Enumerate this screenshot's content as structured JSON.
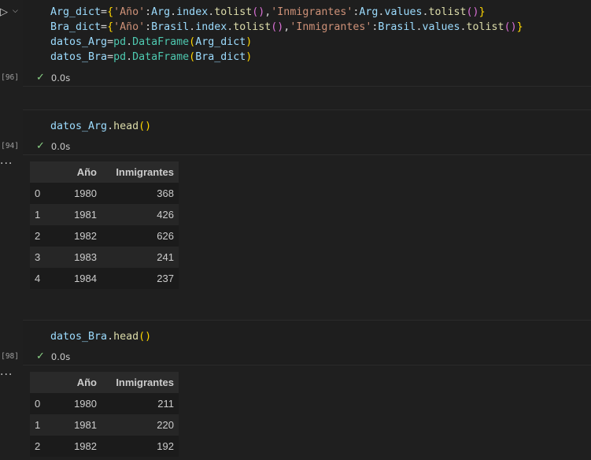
{
  "cell1": {
    "exec": "[96]",
    "status": "0.0s",
    "lines": [
      "Arg_dict={'Año':Arg.index.tolist(),'Inmigrantes':Arg.values.tolist()}",
      "Bra_dict={'Año':Brasil.index.tolist(),'Inmigrantes':Brasil.values.tolist()}",
      "datos_Arg=pd.DataFrame(Arg_dict)",
      "datos_Bra=pd.DataFrame(Bra_dict)"
    ]
  },
  "cell2": {
    "exec": "[94]",
    "status": "0.0s",
    "code": "datos_Arg.head()",
    "table": {
      "headers": [
        "",
        "Año",
        "Inmigrantes"
      ],
      "rows": [
        [
          "0",
          "1980",
          "368"
        ],
        [
          "1",
          "1981",
          "426"
        ],
        [
          "2",
          "1982",
          "626"
        ],
        [
          "3",
          "1983",
          "241"
        ],
        [
          "4",
          "1984",
          "237"
        ]
      ]
    }
  },
  "cell3": {
    "exec": "[98]",
    "status": "0.0s",
    "code": "datos_Bra.head()",
    "table": {
      "headers": [
        "",
        "Año",
        "Inmigrantes"
      ],
      "rows": [
        [
          "0",
          "1980",
          "211"
        ],
        [
          "1",
          "1981",
          "220"
        ],
        [
          "2",
          "1982",
          "192"
        ]
      ]
    }
  },
  "icons": {
    "run": "run-icon",
    "chevron": "chevron-down-icon",
    "check": "check-icon",
    "more": "more-icon"
  }
}
